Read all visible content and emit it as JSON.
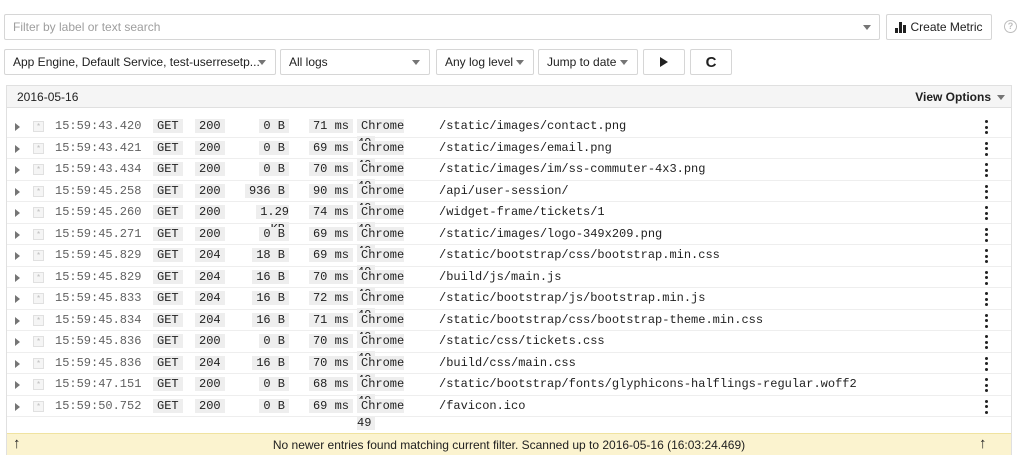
{
  "filter": {
    "placeholder": "Filter by label or text search",
    "value": ""
  },
  "create_metric": {
    "label": "Create Metric",
    "icon": "bar-chart-icon"
  },
  "help_icon": {
    "icon": "help-icon",
    "glyph": "?"
  },
  "controls": {
    "resource": "App Engine, Default Service, test-userresetp...",
    "logs": "All logs",
    "log_level": "Any log level",
    "jump_to_date": "Jump to date",
    "play_icon": "play-icon",
    "refresh_icon": "refresh-icon",
    "refresh_glyph": "C"
  },
  "panel": {
    "date": "2016-05-16",
    "view_options": "View Options"
  },
  "rows": [
    {
      "time": "15:59:43.420",
      "method": "GET",
      "status": "200",
      "size": "0 B",
      "latency": "71 ms",
      "agent": "Chrome 49",
      "path": "/static/images/contact.png"
    },
    {
      "time": "15:59:43.421",
      "method": "GET",
      "status": "200",
      "size": "0 B",
      "latency": "69 ms",
      "agent": "Chrome 49",
      "path": "/static/images/email.png"
    },
    {
      "time": "15:59:43.434",
      "method": "GET",
      "status": "200",
      "size": "0 B",
      "latency": "70 ms",
      "agent": "Chrome 49",
      "path": "/static/images/im/ss-commuter-4x3.png"
    },
    {
      "time": "15:59:45.258",
      "method": "GET",
      "status": "200",
      "size": "936 B",
      "latency": "90 ms",
      "agent": "Chrome 49",
      "path": "/api/user-session/"
    },
    {
      "time": "15:59:45.260",
      "method": "GET",
      "status": "200",
      "size": "1.29 KB",
      "latency": "74 ms",
      "agent": "Chrome 49",
      "path": "/widget-frame/tickets/1"
    },
    {
      "time": "15:59:45.271",
      "method": "GET",
      "status": "200",
      "size": "0 B",
      "latency": "69 ms",
      "agent": "Chrome 49",
      "path": "/static/images/logo-349x209.png"
    },
    {
      "time": "15:59:45.829",
      "method": "GET",
      "status": "204",
      "size": "18 B",
      "latency": "69 ms",
      "agent": "Chrome 49",
      "path": "/static/bootstrap/css/bootstrap.min.css"
    },
    {
      "time": "15:59:45.829",
      "method": "GET",
      "status": "204",
      "size": "16 B",
      "latency": "70 ms",
      "agent": "Chrome 49",
      "path": "/build/js/main.js"
    },
    {
      "time": "15:59:45.833",
      "method": "GET",
      "status": "204",
      "size": "16 B",
      "latency": "72 ms",
      "agent": "Chrome 49",
      "path": "/static/bootstrap/js/bootstrap.min.js"
    },
    {
      "time": "15:59:45.834",
      "method": "GET",
      "status": "204",
      "size": "16 B",
      "latency": "71 ms",
      "agent": "Chrome 49",
      "path": "/static/bootstrap/css/bootstrap-theme.min.css"
    },
    {
      "time": "15:59:45.836",
      "method": "GET",
      "status": "200",
      "size": "0 B",
      "latency": "70 ms",
      "agent": "Chrome 49",
      "path": "/static/css/tickets.css"
    },
    {
      "time": "15:59:45.836",
      "method": "GET",
      "status": "204",
      "size": "16 B",
      "latency": "70 ms",
      "agent": "Chrome 49",
      "path": "/build/css/main.css"
    },
    {
      "time": "15:59:47.151",
      "method": "GET",
      "status": "200",
      "size": "0 B",
      "latency": "68 ms",
      "agent": "Chrome 49",
      "path": "/static/bootstrap/fonts/glyphicons-halflings-regular.woff2"
    },
    {
      "time": "15:59:50.752",
      "method": "GET",
      "status": "200",
      "size": "0 B",
      "latency": "69 ms",
      "agent": "Chrome 49",
      "path": "/favicon.ico"
    }
  ],
  "footer": {
    "message": "No newer entries found matching current filter. Scanned up to 2016-05-16 (16:03:24.469)",
    "arrow_glyph": "↑"
  },
  "colors": {
    "footer_bg": "#fbf3cf",
    "pill_bg": "#eeeeee"
  }
}
